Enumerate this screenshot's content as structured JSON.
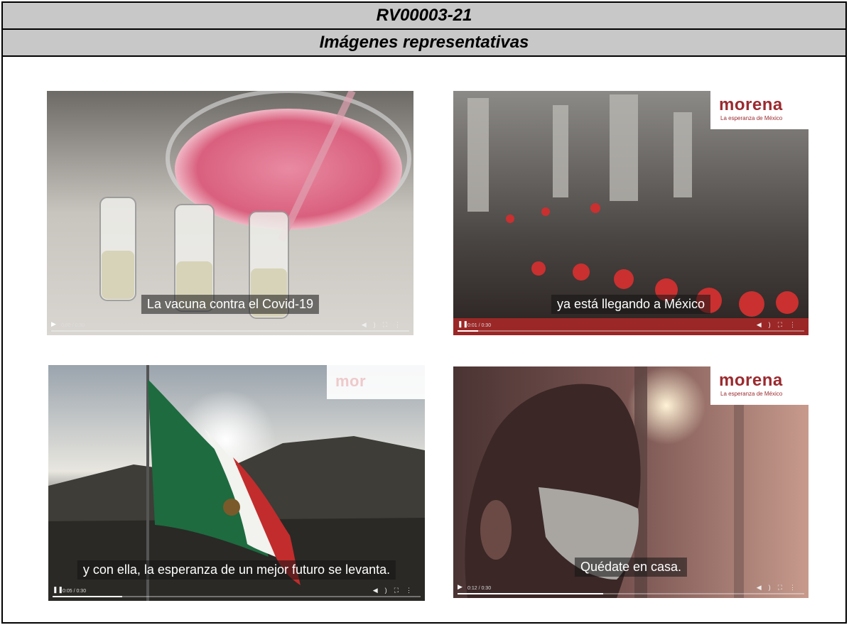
{
  "document": {
    "code": "RV00003-21",
    "section_title": "Imágenes representativas"
  },
  "frames": [
    {
      "caption": "La vacuna contra el Covid-19",
      "time": "0:00 / 0:30",
      "play_state": "play",
      "progress": 0.0,
      "logo": null
    },
    {
      "caption": "ya está llegando a México",
      "time": "0:01 / 0:30",
      "play_state": "pause",
      "progress": 0.06,
      "logo": {
        "name": "morena",
        "tagline": "La esperanza de México"
      }
    },
    {
      "caption": "y con ella, la esperanza de un mejor futuro se levanta.",
      "time": "0:05 / 0:30",
      "play_state": "pause",
      "progress": 0.19,
      "logo_partial": "mor"
    },
    {
      "caption": "Quédate en casa.",
      "time": "0:12 / 0:30",
      "play_state": "play",
      "progress": 0.42,
      "logo": {
        "name": "morena",
        "tagline": "La esperanza de México"
      }
    }
  ],
  "icons": {
    "play": "play-icon",
    "pause": "pause-icon",
    "volume": "volume-icon",
    "fullscreen": "fullscreen-icon",
    "more": "more-vertical-icon"
  },
  "colors": {
    "header_bg": "#c8c8c8",
    "logo_red": "#9b2a2f"
  }
}
